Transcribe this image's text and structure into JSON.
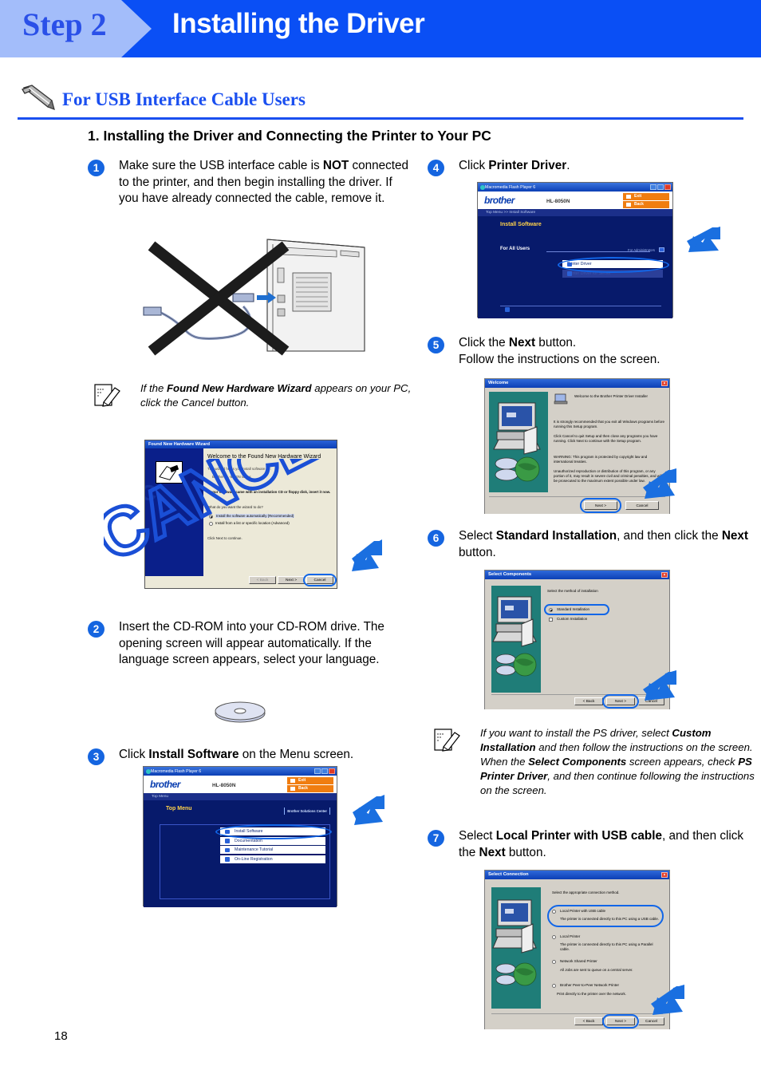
{
  "header": {
    "step_label": "Step 2",
    "title": "Installing the Driver"
  },
  "section": {
    "icon": "usb-cable-icon",
    "title": "For USB Interface Cable Users",
    "subtitle": "1. Installing the Driver and Connecting the Printer to Your PC"
  },
  "steps": {
    "s1": {
      "number": "1",
      "text_parts": [
        {
          "t": "Make sure the USB interface cable is ",
          "b": false
        },
        {
          "t": "NOT",
          "b": true
        },
        {
          "t": " connected to the printer, and then begin installing the driver. If you have already connected the cable, remove it.",
          "b": false
        }
      ]
    },
    "s2": {
      "number": "2",
      "text_parts": [
        {
          "t": "Insert the CD-ROM into your CD-ROM drive. The opening screen will appear automatically. If the language screen appears, select your language.",
          "b": false
        }
      ]
    },
    "s3": {
      "number": "3",
      "text_parts": [
        {
          "t": "Click ",
          "b": false
        },
        {
          "t": "Install Software",
          "b": true
        },
        {
          "t": " on the Menu screen.",
          "b": false
        }
      ]
    },
    "s4": {
      "number": "4",
      "text_parts": [
        {
          "t": "Click ",
          "b": false
        },
        {
          "t": "Printer Driver",
          "b": true
        },
        {
          "t": ".",
          "b": false
        }
      ]
    },
    "s5": {
      "number": "5",
      "text_parts": [
        {
          "t": "Click the ",
          "b": false
        },
        {
          "t": "Next",
          "b": true
        },
        {
          "t": " button.\nFollow the instructions on the screen.",
          "b": false
        }
      ]
    },
    "s6": {
      "number": "6",
      "text_parts": [
        {
          "t": "Select ",
          "b": false
        },
        {
          "t": "Standard Installation",
          "b": true
        },
        {
          "t": ", and then click the ",
          "b": false
        },
        {
          "t": "Next",
          "b": true
        },
        {
          "t": " button.",
          "b": false
        }
      ]
    },
    "s7": {
      "number": "7",
      "text_parts": [
        {
          "t": "Select ",
          "b": false
        },
        {
          "t": "Local Printer with USB cable",
          "b": true
        },
        {
          "t": ", and then click the ",
          "b": false
        },
        {
          "t": "Next",
          "b": true
        },
        {
          "t": " button.",
          "b": false
        }
      ]
    }
  },
  "notes": {
    "note1": {
      "icon": "note-pencil-icon",
      "parts": [
        {
          "t": "If the ",
          "b": false
        },
        {
          "t": "Found New Hardware Wizard",
          "b": true
        },
        {
          "t": " appears on your PC, click the Cancel button.",
          "b": false
        }
      ]
    },
    "note2": {
      "icon": "note-pencil-icon",
      "parts": [
        {
          "t": "If you want to install the PS driver, select ",
          "b": false
        },
        {
          "t": "Custom Installation",
          "b": true
        },
        {
          "t": " and then follow the instructions on the screen. When the ",
          "b": false
        },
        {
          "t": "Select Components",
          "b": true
        },
        {
          "t": " screen appears, check ",
          "b": false
        },
        {
          "t": "PS Printer Driver",
          "b": true
        },
        {
          "t": ", and then continue following the instructions on the screen.",
          "b": false
        }
      ]
    }
  },
  "figures": {
    "printer_usb": {
      "name": "printer-usb-cable-crossed-out",
      "overlay": "cross-out-x"
    },
    "cdrom": {
      "name": "cd-rom-disc"
    },
    "found_new_hardware": {
      "title": "Found New Hardware Wizard",
      "heading": "Welcome to the Found New Hardware Wizard",
      "body1": "This wizard helps you install software for:",
      "device": "Brother HL-8050N series",
      "body2": "If your hardware came with an installation CD or floppy disk, insert it now.",
      "question": "What do you want the wizard to do?",
      "option1": "Install the software automatically (Recommended)",
      "option2": "Install from a list or specific location (Advanced)",
      "footer": "Click Next to continue.",
      "buttons": [
        "< Back",
        "Next >",
        "Cancel"
      ],
      "highlight": "Cancel",
      "watermark": "CANCEL"
    },
    "top_menu": {
      "window_title": "Macromedia Flash Player 6",
      "brand": "brother",
      "model": "HL-8050N",
      "exit_label": "Exit",
      "back_label": "Back",
      "breadcrumb": "Top Menu",
      "page_title": "Top Menu",
      "solutions_center": "Brother Solutions Center",
      "menu_items": [
        "Install Software",
        "Documentation",
        "Maintenance Tutorial",
        "On-Line Registration"
      ],
      "highlight": "Install Software"
    },
    "install_software": {
      "window_title": "Macromedia Flash Player 6",
      "brand": "brother",
      "model": "HL-8050N",
      "exit_label": "Exit",
      "back_label": "Back",
      "breadcrumb": "Top Menu >> Install Software",
      "page_title": "Install Software",
      "group_label": "For All Users",
      "admin_label": "For Administrators",
      "menu_items": [
        "Printer Driver",
        "Printer Driver for Server"
      ],
      "highlight": "Printer Driver"
    },
    "welcome": {
      "title": "Welcome",
      "heading": "Welcome to the Brother Printer Driver Installer",
      "para1": "It is strongly recommended that you exit all Windows programs before running this Setup program.",
      "para2": "Click Cancel to quit Setup and then close any programs you have running. Click Next to continue with the Setup program.",
      "para3": "WARNING: This program is protected by copyright law and international treaties.",
      "para4": "Unauthorized reproduction or distribution of this program, or any portion of it, may result in severe civil and criminal penalties, and will be prosecuted to the maximum extent possible under law.",
      "buttons": [
        "Next >",
        "Cancel"
      ],
      "highlight": "Next >"
    },
    "select_components": {
      "title": "Select Components",
      "prompt": "Select the method of installation",
      "option1": "Standard Installation",
      "option2": "Custom Installation",
      "buttons": [
        "< Back",
        "Next >",
        "Cancel"
      ],
      "highlight_option": "Standard Installation",
      "highlight_button": "Next >"
    },
    "select_connection": {
      "title": "Select Connection",
      "prompt": "Select the appropriate connection method.",
      "options": [
        {
          "label": "Local Printer with USB cable",
          "desc": "The printer is connected directly to this PC using a USB cable."
        },
        {
          "label": "Local Printer",
          "desc": "The printer is connected directly to this PC using a Parallel cable."
        },
        {
          "label": "Network Shared Printer",
          "desc": "All Jobs are sent to queue on a central server."
        },
        {
          "label": "Brother Peer-to-Peer Network Printer",
          "desc": "Print directly to the printer over the network."
        }
      ],
      "buttons": [
        "< Back",
        "Next >",
        "Cancel"
      ],
      "highlight_option": "Local Printer with USB cable",
      "highlight_button": "Next >"
    }
  },
  "footer": {
    "page_number": "18"
  },
  "colors": {
    "header_blue": "#0a4ff5",
    "header_light": "#a3bdfa",
    "accent_blue": "#1a4ff0",
    "number_badge": "#1565e0",
    "highlight_ring": "#1166e8",
    "orange_button": "#f07d10",
    "installer_teal": "#1f7d78"
  }
}
